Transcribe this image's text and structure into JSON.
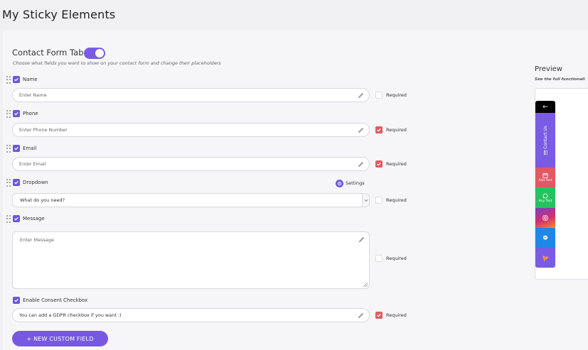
{
  "page": {
    "title": "My Sticky Elements"
  },
  "form": {
    "tab_title": "Contact Form Tab",
    "tab_enabled": true,
    "subtitle": "Choose what fields you want to show on your contact form and change their placeholders",
    "fields": [
      {
        "label": "Name",
        "placeholder": "Enter Name",
        "enabled": true,
        "required": false
      },
      {
        "label": "Phone",
        "placeholder": "Enter Phone Number",
        "enabled": true,
        "required": true
      },
      {
        "label": "Email",
        "placeholder": "Enter Email",
        "enabled": true,
        "required": true
      },
      {
        "label": "Dropdown",
        "value": "What do you need?",
        "settings_label": "Settings",
        "enabled": true,
        "required": false
      },
      {
        "label": "Message",
        "placeholder": "Enter Message",
        "enabled": true,
        "required": false
      },
      {
        "label": "Enable Consent Checkbox",
        "value": "You can add a GDPR checkbox if you want :)",
        "enabled": true,
        "required": true
      }
    ],
    "required_label": "Required",
    "new_field_button": "+ NEW CUSTOM FIELD"
  },
  "preview": {
    "title": "Preview",
    "subtitle": "See the full functionali",
    "items": [
      {
        "icon": "arrow-left-icon",
        "label": "",
        "color": "#000000"
      },
      {
        "icon": "envelope-icon",
        "label": "Contact Us",
        "color": "#7a5be6"
      },
      {
        "icon": "calendar-icon",
        "label": "Add Text",
        "color": "#e35865"
      },
      {
        "icon": "whatsapp-icon",
        "label": "Any Text",
        "color": "#24c35e"
      },
      {
        "icon": "instagram-icon",
        "label": "",
        "color": "#d3306e"
      },
      {
        "icon": "messenger-icon",
        "label": "",
        "color": "#1f87e8"
      },
      {
        "icon": "pizza-icon",
        "label": "",
        "color": "#7a5be6"
      }
    ]
  },
  "colors": {
    "accent": "#7659e0",
    "required_checked": "#e05a5f",
    "checkbox": "#6c57dc"
  }
}
